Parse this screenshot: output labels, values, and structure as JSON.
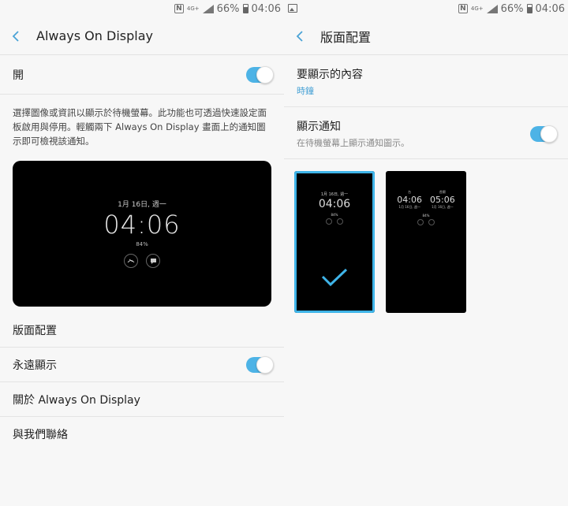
{
  "status": {
    "network": "4G+",
    "battery": "66%",
    "time": "04:06"
  },
  "left": {
    "header_title": "Always On Display",
    "master_switch_label": "開",
    "description": "選擇圖像或資訊以顯示於待機螢幕。此功能也可透過快速設定面板啟用與停用。輕觸兩下 Always On Display 畫面上的通知圖示即可檢視該通知。",
    "preview": {
      "date": "1月 16日, 週一",
      "time": "04:06",
      "battery": "84%"
    },
    "items": [
      {
        "label": "版面配置"
      },
      {
        "label": "永遠顯示"
      },
      {
        "label": "關於 Always On Display"
      },
      {
        "label": "與我們聯絡"
      }
    ],
    "toggles": {
      "master": true,
      "always_show": true
    }
  },
  "right": {
    "header_title": "版面配置",
    "content_label": "要顯示的內容",
    "content_value": "時鐘",
    "notify_label": "顯示通知",
    "notify_desc": "在待機螢幕上顯示通知圖示。",
    "notify_on": true,
    "thumb1": {
      "date": "1月 16日, 週一",
      "time": "04:06",
      "battery": "84%"
    },
    "thumb2": {
      "left_city": "台",
      "left_time": "04:06",
      "left_date": "1月 16日, 週一",
      "right_city": "首爾",
      "right_time": "05:06",
      "right_date": "1月 16日, 週一",
      "battery": "84%"
    }
  },
  "colors": {
    "accent": "#4db3e6",
    "selected_border": "#3fb4e8"
  }
}
